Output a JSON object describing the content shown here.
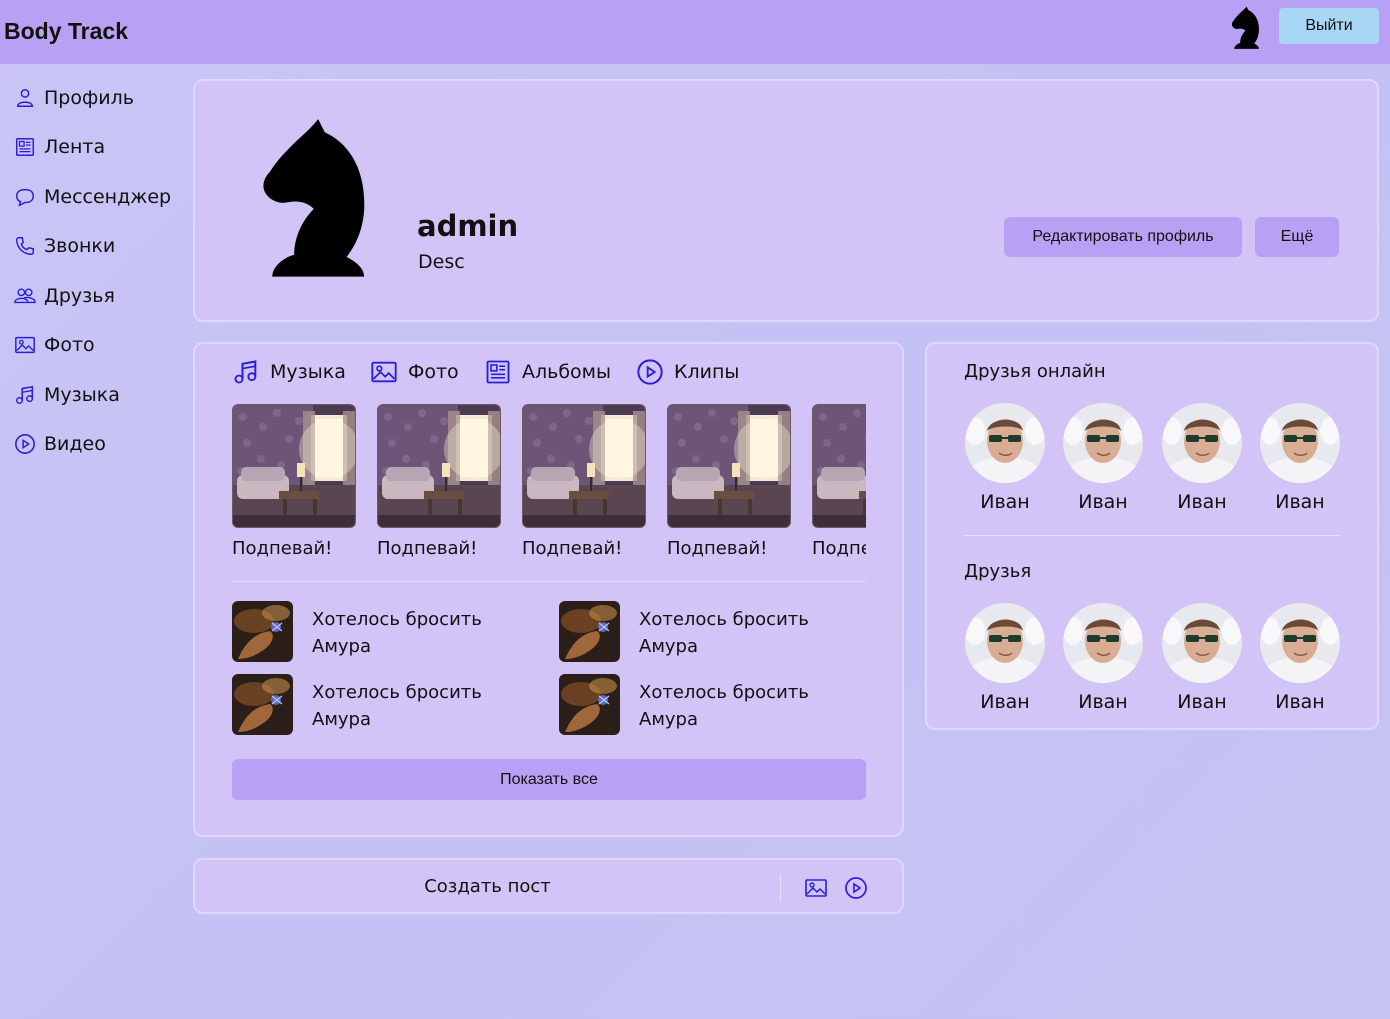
{
  "header": {
    "logo": "Body Track",
    "logout_label": "Выйти"
  },
  "sidebar": {
    "items": [
      {
        "label": "Профиль",
        "icon": "user-icon"
      },
      {
        "label": "Лента",
        "icon": "news-icon"
      },
      {
        "label": "Мессенджер",
        "icon": "chat-icon"
      },
      {
        "label": "Звонки",
        "icon": "phone-icon"
      },
      {
        "label": "Друзья",
        "icon": "friends-icon"
      },
      {
        "label": "Фото",
        "icon": "image-icon"
      },
      {
        "label": "Музыка",
        "icon": "music-icon"
      },
      {
        "label": "Видео",
        "icon": "play-icon"
      }
    ]
  },
  "profile": {
    "username": "admin",
    "description": "Desc",
    "edit_label": "Редактировать профиль",
    "more_label": "Ещё"
  },
  "media": {
    "tabs": [
      {
        "label": "Музыка",
        "icon": "music-icon"
      },
      {
        "label": "Фото",
        "icon": "image-icon"
      },
      {
        "label": "Альбомы",
        "icon": "news-icon"
      },
      {
        "label": "Клипы",
        "icon": "play-icon"
      }
    ],
    "albums": [
      "Подпевай!",
      "Подпевай!",
      "Подпевай!",
      "Подпевай!",
      "Подпевай!"
    ],
    "tracks": [
      {
        "title": "Хотелось бросить Амура"
      },
      {
        "title": "Хотелось бросить Амура"
      },
      {
        "title": "Хотелось бросить Амура"
      },
      {
        "title": "Хотелось бросить Амура"
      }
    ],
    "show_all_label": "Показать все"
  },
  "post": {
    "create_label": "Создать пост"
  },
  "friends": {
    "online_title": "Друзья онлайн",
    "online": [
      "Иван",
      "Иван",
      "Иван",
      "Иван"
    ],
    "all_title": "Друзья",
    "all": [
      "Иван",
      "Иван",
      "Иван",
      "Иван"
    ]
  },
  "colors": {
    "header": "#b8a1f4",
    "card": "#d2c4f6",
    "button": "#b8a1f4",
    "logout_button": "#a8d6f5",
    "icon": "#2a1fd8"
  }
}
